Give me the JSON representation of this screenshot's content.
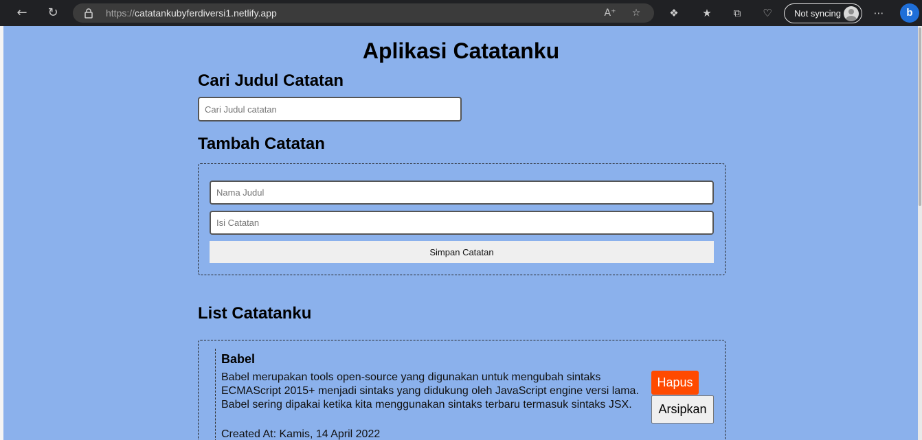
{
  "browser": {
    "url_scheme": "https://",
    "url_host": "catatankubyferdiversi1.netlify.app",
    "sync_label": "Not syncing",
    "icons": [
      "back-icon",
      "refresh-icon",
      "lock-icon",
      "read-aloud-icon",
      "favorite-star-icon",
      "extensions-icon",
      "favorites-icon",
      "collections-icon",
      "browser-essentials-icon",
      "avatar-icon",
      "more-icon",
      "bing-icon"
    ]
  },
  "app": {
    "title": "Aplikasi Catatanku",
    "search": {
      "heading": "Cari Judul Catatan",
      "placeholder": "Cari Judul catatan"
    },
    "add": {
      "heading": "Tambah Catatan",
      "title_placeholder": "Nama Judul",
      "body_placeholder": "Isi Catatan",
      "submit_label": "Simpan Catatan"
    },
    "list": {
      "heading": "List Catatanku",
      "notes": [
        {
          "title": "Babel",
          "body": "Babel merupakan tools open-source yang digunakan untuk mengubah sintaks ECMAScript 2015+ menjadi sintaks yang didukung oleh JavaScript engine versi lama. Babel sering dipakai ketika kita menggunakan sintaks terbaru termasuk sintaks JSX.",
          "created": "Created At: Kamis, 14 April 2022",
          "delete_label": "Hapus",
          "archive_label": "Arsipkan"
        }
      ]
    }
  },
  "colors": {
    "page_bg": "#8bb1ec",
    "delete_bg": "#ff4a00"
  }
}
